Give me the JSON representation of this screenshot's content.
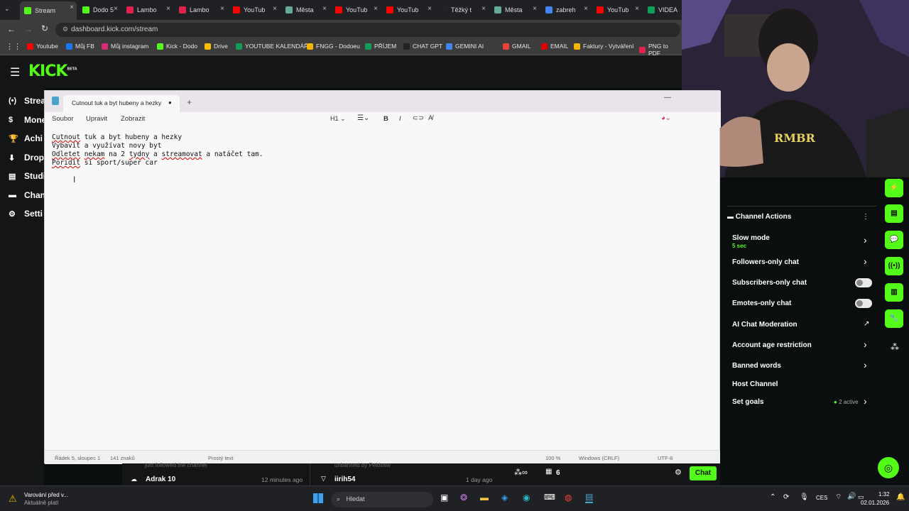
{
  "browser": {
    "tabs": [
      {
        "label": "Stream",
        "color": "#53fc18",
        "active": true
      },
      {
        "label": "Dodo 5",
        "color": "#53fc18"
      },
      {
        "label": "Lambo",
        "color": "#e0224f"
      },
      {
        "label": "Lambo",
        "color": "#e0224f"
      },
      {
        "label": "YouTub",
        "color": "#ff0000"
      },
      {
        "label": "Města",
        "color": "#6a9"
      },
      {
        "label": "YouTub",
        "color": "#ff0000"
      },
      {
        "label": "YouTub",
        "color": "#ff0000"
      },
      {
        "label": "Těžký t",
        "color": "#222"
      },
      {
        "label": "Města",
        "color": "#6a9"
      },
      {
        "label": "zabreh",
        "color": "#4285f4"
      },
      {
        "label": "YouTub",
        "color": "#ff0000"
      },
      {
        "label": "VIDEA",
        "color": "#0f9d58"
      }
    ],
    "url": "dashboard.kick.com/stream",
    "bookmarks": [
      {
        "label": "Youtube",
        "color": "#ff0000"
      },
      {
        "label": "Můj FB",
        "color": "#1877f2"
      },
      {
        "label": "Můj instagram",
        "color": "#d62976"
      },
      {
        "label": "Kick - Dodo",
        "color": "#53fc18"
      },
      {
        "label": "Drive",
        "color": "#fbbc04"
      },
      {
        "label": "YOUTUBE KALENDÁŘ",
        "color": "#0f9d58"
      },
      {
        "label": "FNGG - Dodoeu",
        "color": "#f4b400"
      },
      {
        "label": "PŘÍJEM",
        "color": "#0f9d58"
      },
      {
        "label": "CHAT GPT",
        "color": "#222"
      },
      {
        "label": "GEMINI AI",
        "color": "#4285f4"
      },
      {
        "label": "GMAIL",
        "color": "#ea4335"
      },
      {
        "label": "EMAIL",
        "color": "#d00"
      },
      {
        "label": "Faktury - Vytváření",
        "color": "#f4b400"
      },
      {
        "label": "PNG to PDF",
        "color": "#e0224f"
      }
    ]
  },
  "kick": {
    "logo": "KICK",
    "logo_badge": "BETA",
    "sidebar": [
      "Strea",
      "Mone",
      "Achi",
      "Drops",
      "Studi",
      "Chan",
      "Setti"
    ]
  },
  "notepad": {
    "tab_title": "Cutnout tuk a byt hubeny a hezky",
    "menu": [
      "Soubor",
      "Upravit",
      "Zobrazit"
    ],
    "heading_select": "H1",
    "lines": [
      "Cutnout tuk a byt hubeny a hezky",
      "Vybavit a využívat novy byt",
      "Odletet nekam na 2 tydny a streamovat a natáčet tam.",
      "Poridit si sport/super car"
    ],
    "status": {
      "position": "Řádek 5, sloupec 1",
      "chars": "141 znaků",
      "format": "Prostý text",
      "zoom": "100 %",
      "eol": "Windows (CRLF)",
      "encoding": "UTF-8"
    }
  },
  "channel_actions": {
    "title": "Channel Actions",
    "items": [
      {
        "label": "Slow mode",
        "sub": "5 sec",
        "control": "chevron"
      },
      {
        "label": "Followers-only chat",
        "control": "chevron"
      },
      {
        "label": "Subscribers-only chat",
        "control": "toggle"
      },
      {
        "label": "Emotes-only chat",
        "control": "toggle"
      },
      {
        "label": "AI Chat Moderation",
        "control": "external"
      },
      {
        "label": "Account age restriction",
        "control": "chevron"
      },
      {
        "label": "Banned words",
        "control": "chevron"
      },
      {
        "label": "Host Channel",
        "control": "none"
      },
      {
        "label": "Set goals",
        "badge": "2 active",
        "control": "chevron"
      }
    ]
  },
  "feed": {
    "item1_title": "just followed the channel",
    "item1_user": "Adrak 10",
    "item1_time": "12 minutes ago",
    "item2_title": "unbanned by Peldosw",
    "item2_user": "iirih54",
    "item2_time": "1 day ago",
    "viewers": "6",
    "chat_button": "Chat"
  },
  "taskbar": {
    "warning_title": "Varování před v...",
    "warning_sub": "Aktuálně platí",
    "search_placeholder": "Hledat",
    "lang": "CES",
    "time": "1:32",
    "date": "02.01.2026"
  },
  "colors": {
    "accent": "#53fc18"
  }
}
